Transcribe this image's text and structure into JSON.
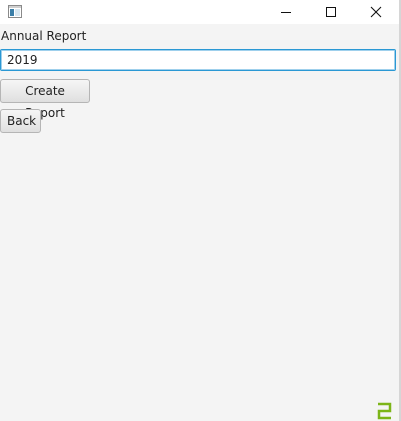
{
  "window": {
    "title": "",
    "icon": "app-window-icon",
    "controls": [
      "minimize-icon",
      "maximize-icon",
      "close-icon"
    ]
  },
  "form": {
    "label": "Annual Report",
    "year_value": "2019",
    "create_button": "Create Report",
    "back_button": "Back"
  },
  "colors": {
    "focus_border": "#2a98d4",
    "corner_mark": "#7cb518",
    "background": "#f4f4f4"
  },
  "corner_mark_icon": "green-corner-glyph-icon"
}
